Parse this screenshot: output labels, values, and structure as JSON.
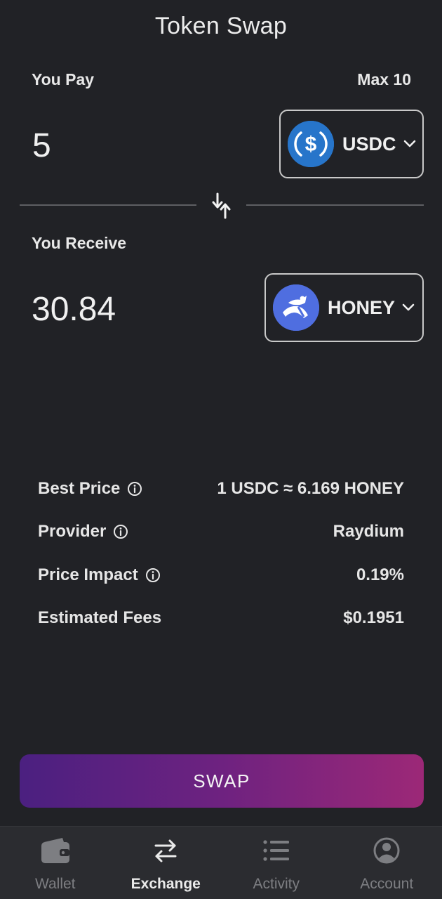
{
  "header": {
    "title": "Token Swap"
  },
  "pay": {
    "label": "You Pay",
    "max_label": "Max 10",
    "amount": "5",
    "token": {
      "symbol": "USDC",
      "icon": "usdc-logo-icon",
      "color": "#2775ca"
    }
  },
  "receive": {
    "label": "You Receive",
    "amount": "30.84",
    "token": {
      "symbol": "HONEY",
      "icon": "honey-logo-icon",
      "color": "#4f6ee0"
    }
  },
  "details": [
    {
      "key": "Best Price",
      "info": true,
      "value": "1 USDC ≈ 6.169 HONEY"
    },
    {
      "key": "Provider",
      "info": true,
      "value": "Raydium"
    },
    {
      "key": "Price Impact",
      "info": true,
      "value": "0.19%"
    },
    {
      "key": "Estimated Fees",
      "info": false,
      "value": "$0.1951"
    }
  ],
  "swap_button": {
    "label": "SWAP"
  },
  "nav": {
    "items": [
      {
        "label": "Wallet",
        "icon": "wallet-icon",
        "active": false
      },
      {
        "label": "Exchange",
        "icon": "exchange-icon",
        "active": true
      },
      {
        "label": "Activity",
        "icon": "list-icon",
        "active": false
      },
      {
        "label": "Account",
        "icon": "account-icon",
        "active": false
      }
    ]
  },
  "colors": {
    "background": "#212226",
    "nav_background": "#2b2c30",
    "swap_gradient_start": "#4b2080",
    "swap_gradient_end": "#9c2877"
  }
}
